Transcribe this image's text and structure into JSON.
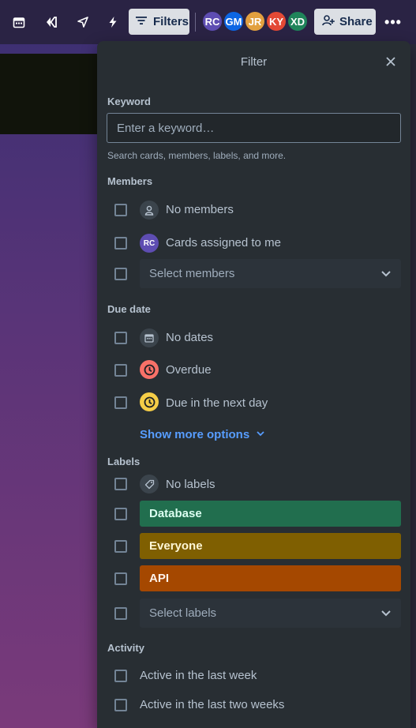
{
  "topbar": {
    "filters_label": "Filters",
    "share_label": "Share",
    "more_label": "•••",
    "avatars": [
      {
        "initials": "RC",
        "color": "#5e4db2"
      },
      {
        "initials": "GM",
        "color": "#0c66e4"
      },
      {
        "initials": "JR",
        "color": "#e2a03f"
      },
      {
        "initials": "KY",
        "color": "#e34935"
      },
      {
        "initials": "XD",
        "color": "#1f845a"
      }
    ]
  },
  "filter": {
    "title": "Filter",
    "keyword": {
      "label": "Keyword",
      "placeholder": "Enter a keyword…",
      "hint": "Search cards, members, labels, and more."
    },
    "members": {
      "label": "Members",
      "no_members": "No members",
      "assigned_to_me": "Cards assigned to me",
      "assigned_avatar": "RC",
      "select_placeholder": "Select members"
    },
    "due_date": {
      "label": "Due date",
      "no_dates": "No dates",
      "overdue": "Overdue",
      "next_day": "Due in the next day",
      "show_more": "Show more options",
      "overdue_color": "#f87168",
      "next_day_color": "#f5cd47"
    },
    "labels": {
      "label": "Labels",
      "no_labels": "No labels",
      "items": [
        {
          "name": "Database",
          "color": "#216e4e",
          "text_color": "#dcfff1"
        },
        {
          "name": "Everyone",
          "color": "#7f5f01",
          "text_color": "#fff7d6"
        },
        {
          "name": "API",
          "color": "#a54800",
          "text_color": "#fff3eb"
        }
      ],
      "select_placeholder": "Select labels"
    },
    "activity": {
      "label": "Activity",
      "last_week": "Active in the last week",
      "last_two_weeks": "Active in the last two weeks"
    }
  }
}
